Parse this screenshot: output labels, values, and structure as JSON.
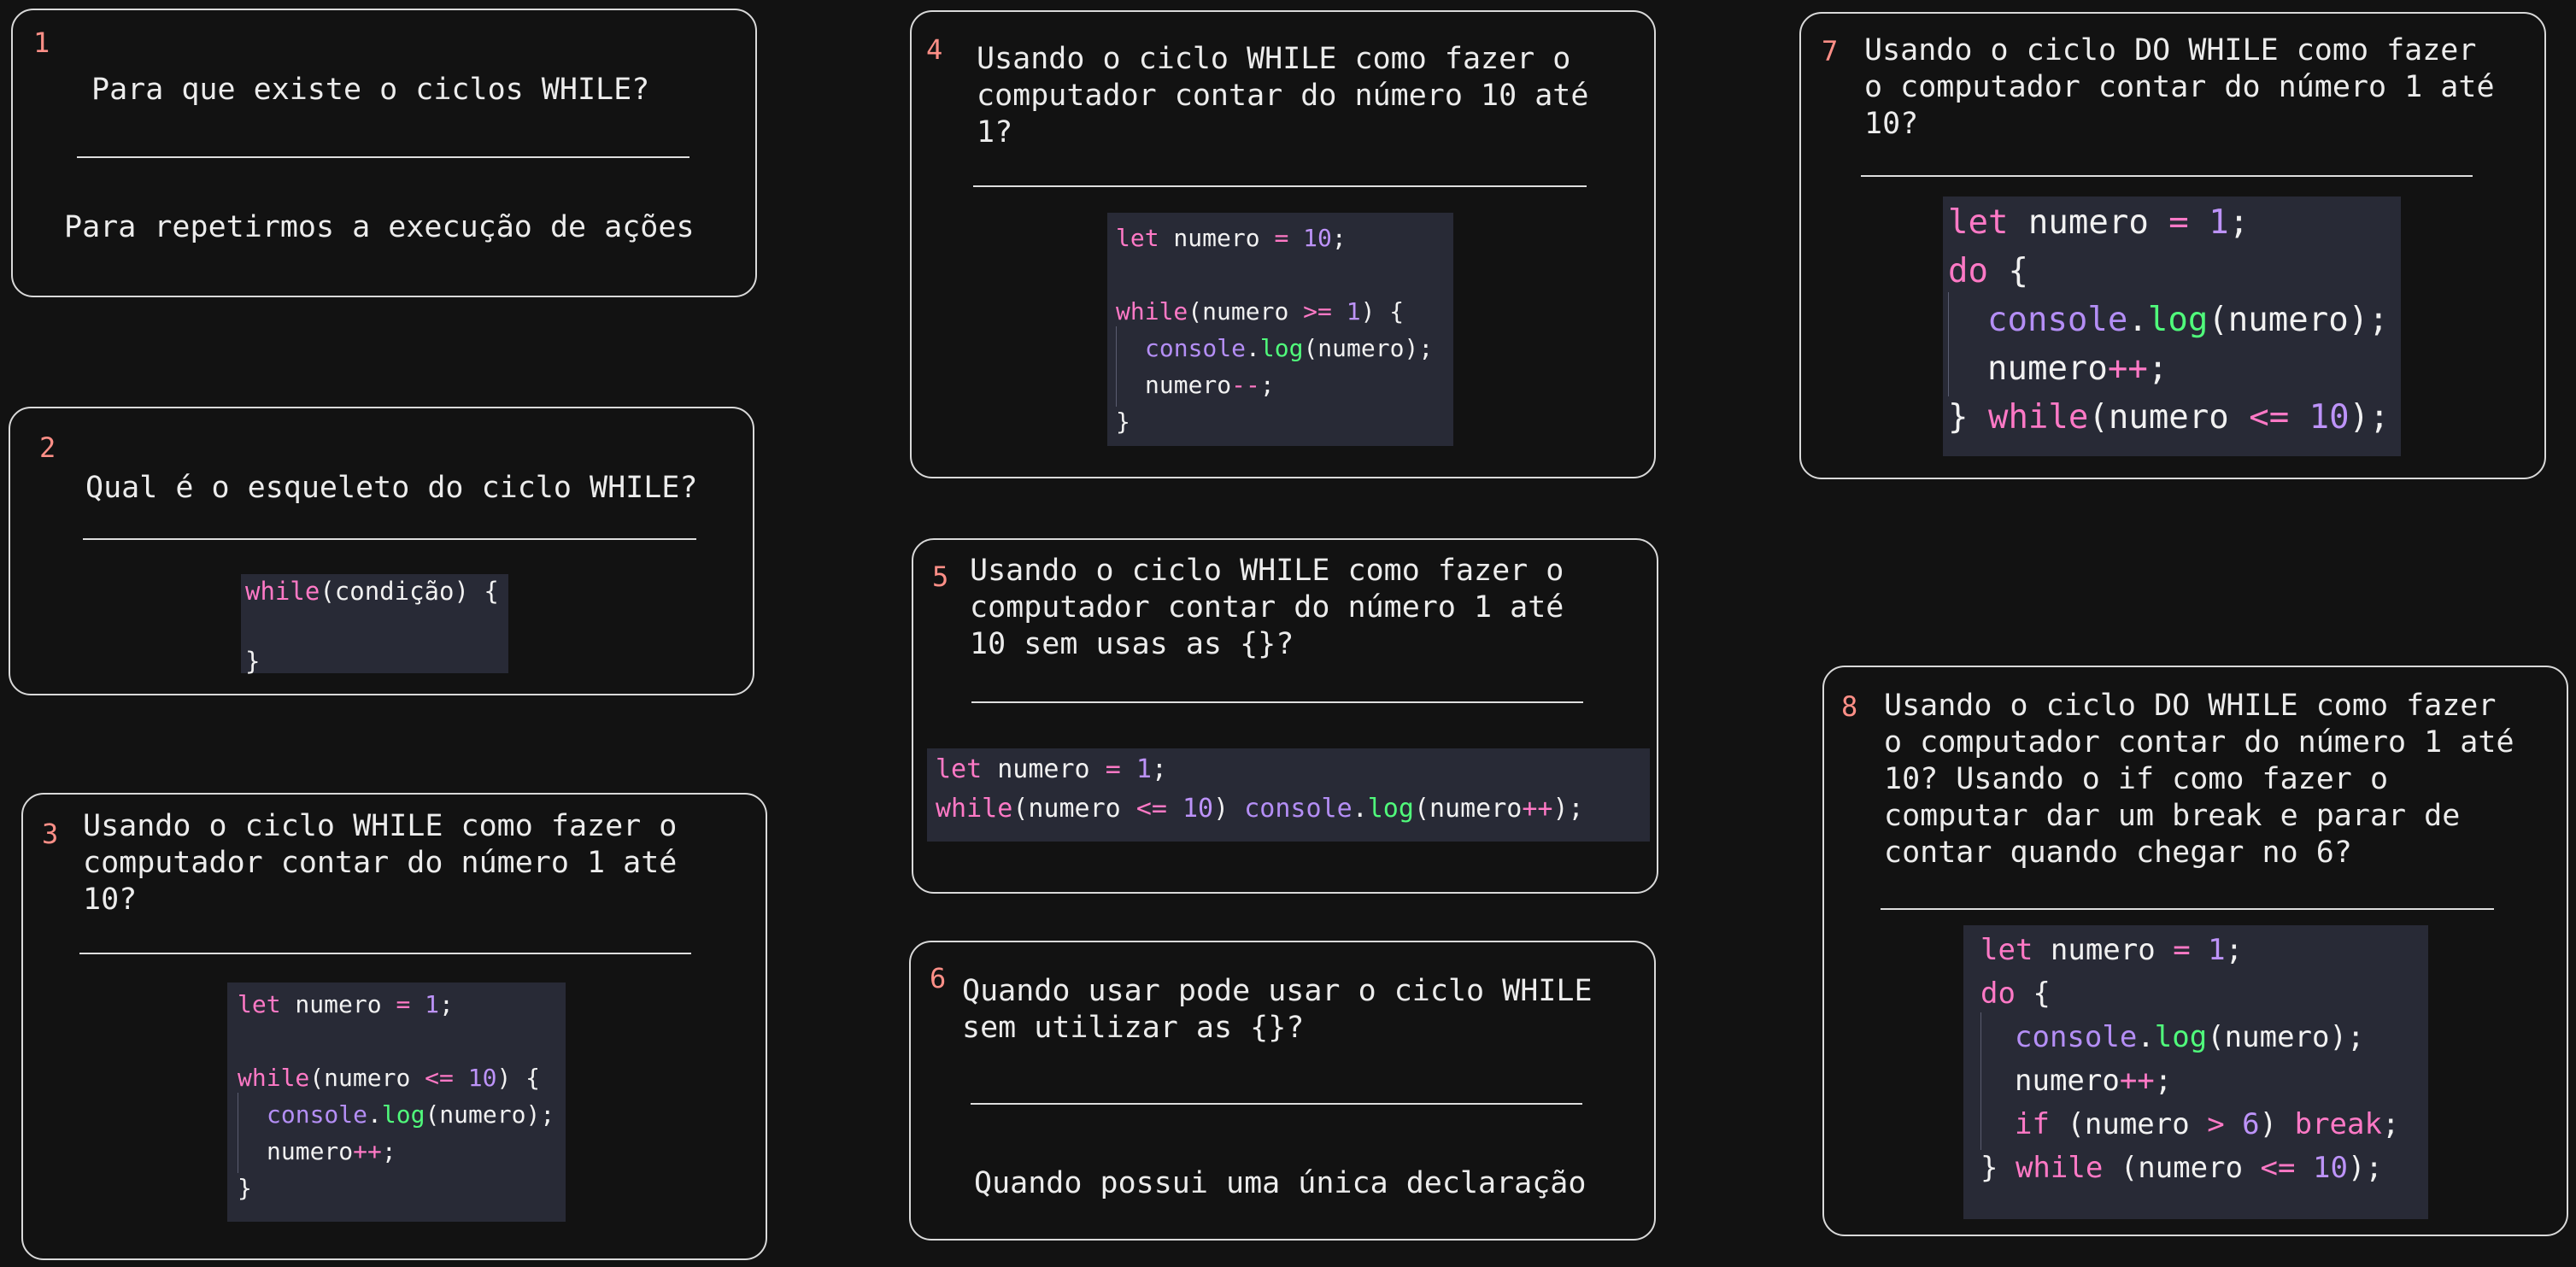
{
  "cards": [
    {
      "number": "1",
      "question": "Para que existe o ciclos WHILE?",
      "answer": "Para repetirmos a execução de ações"
    },
    {
      "number": "2",
      "question": "Qual é o esqueleto do ciclo WHILE?",
      "code": {
        "line1_kw": "while",
        "line1_rest": "(condição) {",
        "line3": "}"
      }
    },
    {
      "number": "3",
      "question": "Usando o ciclo WHILE como fazer o\ncomputador contar do número 1 até\n10?",
      "code": {
        "l1_kw": "let",
        "l1_var": " numero ",
        "l1_op": "=",
        "l1_sp": " ",
        "l1_num": "1",
        "l1_end": ";",
        "l3_kw": "while",
        "l3_a": "(numero ",
        "l3_op": "<=",
        "l3_sp": " ",
        "l3_num": "10",
        "l3_end": ") {",
        "l4_obj": "console",
        "l4_dot": ".",
        "l4_fn": "log",
        "l4_rest": "(numero);",
        "l5_var": "numero",
        "l5_op": "++",
        "l5_end": ";",
        "l6": "}"
      }
    },
    {
      "number": "4",
      "question": "Usando o ciclo WHILE como fazer o\ncomputador contar do número 10 até\n1?",
      "code": {
        "l1_kw": "let",
        "l1_var": " numero ",
        "l1_op": "=",
        "l1_sp": " ",
        "l1_num": "10",
        "l1_end": ";",
        "l3_kw": "while",
        "l3_a": "(numero ",
        "l3_op": ">=",
        "l3_sp": " ",
        "l3_num": "1",
        "l3_end": ") {",
        "l4_obj": "console",
        "l4_dot": ".",
        "l4_fn": "log",
        "l4_rest": "(numero);",
        "l5_var": "numero",
        "l5_op": "--",
        "l5_end": ";",
        "l6": "}"
      }
    },
    {
      "number": "5",
      "question": "Usando o ciclo WHILE como fazer o\ncomputador contar do número 1 até\n10 sem usas as {}?",
      "code": {
        "l1_kw": "let",
        "l1_var": " numero ",
        "l1_op": "=",
        "l1_sp": " ",
        "l1_num": "1",
        "l1_end": ";",
        "l2_kw": "while",
        "l2_a": "(numero ",
        "l2_op": "<=",
        "l2_sp": " ",
        "l2_num": "10",
        "l2_b": ") ",
        "l2_obj": "console",
        "l2_dot": ".",
        "l2_fn": "log",
        "l2_c": "(numero",
        "l2_op2": "++",
        "l2_end": ");"
      }
    },
    {
      "number": "6",
      "question": "Quando usar pode usar o ciclo WHILE\nsem utilizar as {}?",
      "answer": "Quando possui uma única declaração"
    },
    {
      "number": "7",
      "question": "Usando o ciclo DO WHILE como fazer\no computador contar do número 1 até\n10?",
      "code": {
        "l1_kw": "let",
        "l1_var": " numero ",
        "l1_op": "=",
        "l1_sp": " ",
        "l1_num": "1",
        "l1_end": ";",
        "l2_kw": "do",
        "l2_end": " {",
        "l3_obj": "console",
        "l3_dot": ".",
        "l3_fn": "log",
        "l3_rest": "(numero);",
        "l4_var": "numero",
        "l4_op": "++",
        "l4_end": ";",
        "l5_a": "} ",
        "l5_kw": "while",
        "l5_b": "(numero ",
        "l5_op": "<=",
        "l5_sp": " ",
        "l5_num": "10",
        "l5_end": ");"
      }
    },
    {
      "number": "8",
      "question": "Usando o ciclo DO WHILE como fazer\no computador contar do número 1 até\n10? Usando o if como fazer o\ncomputar dar um break e parar de\ncontar quando chegar no 6?",
      "code": {
        "l1_kw": "let",
        "l1_var": " numero ",
        "l1_op": "=",
        "l1_sp": " ",
        "l1_num": "1",
        "l1_end": ";",
        "l2_kw": "do",
        "l2_end": " {",
        "l3_obj": "console",
        "l3_dot": ".",
        "l3_fn": "log",
        "l3_rest": "(numero);",
        "l4_var": "numero",
        "l4_op": "++",
        "l4_end": ";",
        "l5_kw": "if",
        "l5_a": " (numero ",
        "l5_op": ">",
        "l5_sp": " ",
        "l5_num": "6",
        "l5_b": ") ",
        "l5_kw2": "break",
        "l5_end": ";",
        "l6_a": "} ",
        "l6_kw": "while",
        "l6_b": " (numero ",
        "l6_op": "<=",
        "l6_sp": " ",
        "l6_num": "10",
        "l6_end": ");"
      }
    }
  ],
  "colors": {
    "background": "#121212",
    "card_border": "#d9d9d9",
    "card_number": "#ff8f87",
    "code_bg": "#282a36",
    "keyword": "#ff79c6",
    "number": "#bd93f9",
    "function": "#50fa7b"
  }
}
